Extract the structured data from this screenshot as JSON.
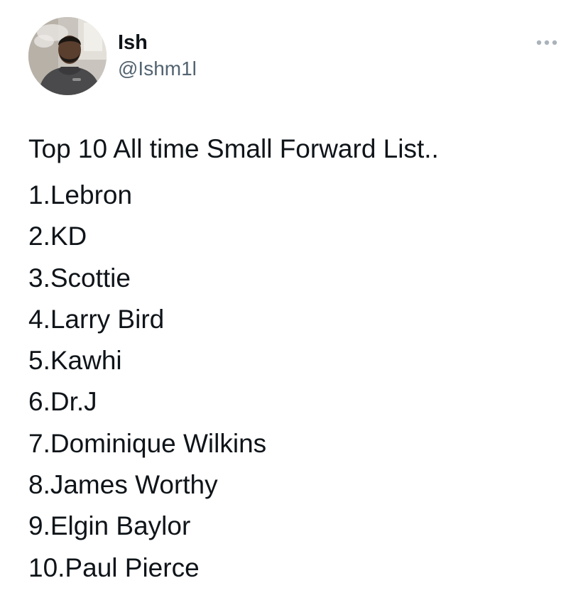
{
  "author": {
    "display_name": "Ish",
    "handle": "@Ishm1l"
  },
  "icons": {
    "more": "more-options-icon"
  },
  "tweet": {
    "title": "Top 10 All time Small Forward List..",
    "list": [
      "1.Lebron",
      "2.KD",
      "3.Scottie",
      "4.Larry Bird",
      "5.Kawhi",
      "6.Dr.J",
      "7.Dominique Wilkins",
      "8.James Worthy",
      "9.Elgin Baylor",
      "10.Paul Pierce"
    ]
  },
  "colors": {
    "text": "#0f1419",
    "secondary": "#536471",
    "background": "#ffffff"
  }
}
